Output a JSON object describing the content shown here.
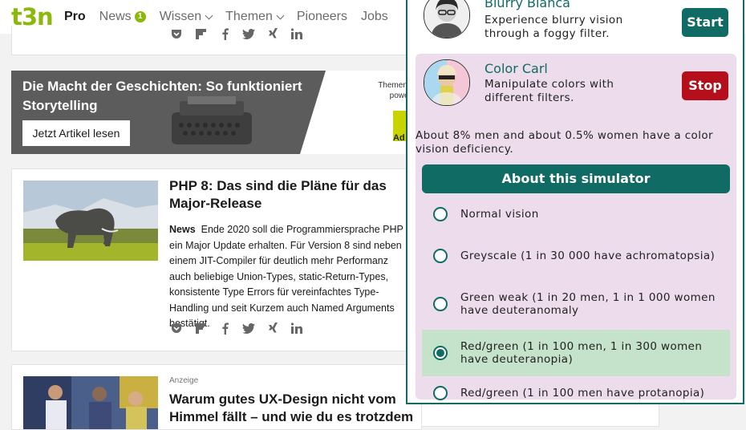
{
  "nav": {
    "logo": "t3n",
    "items": [
      {
        "label": "Pro"
      },
      {
        "label": "News",
        "badge": "1"
      },
      {
        "label": "Wissen"
      },
      {
        "label": "Themen"
      },
      {
        "label": "Pioneers"
      },
      {
        "label": "Jobs"
      }
    ]
  },
  "share_icons": [
    "pocket-icon",
    "flipboard-icon",
    "facebook-icon",
    "twitter-icon",
    "xing-icon",
    "linkedin-icon"
  ],
  "promo": {
    "title": "Die Macht der Geschichten: So funktioniert Storytelling",
    "button": "Jetzt Artikel lesen",
    "sponsor_line1": "Themenspe",
    "sponsor_line2": "powered",
    "sponsor_logo_text": "Ad"
  },
  "article": {
    "title": "PHP 8: Das sind die Pläne für das Major-Release",
    "tag": "News",
    "body": "Ende 2020 soll die Programmiersprache PHP ein Major Update erhalten. Für Version 8 sind neben einem JIT-Compiler für deutlich mehr Performanz auch beliebige Union-Types, static-Return-Types, konsistente Type Errors für vereinfachtes Type-Handling und seit Kurzem auch Named Arguments bestätigt."
  },
  "ad_article": {
    "label": "Anzeige",
    "title": "Warum gutes UX-Design nicht vom Himmel fällt – und wie du es trotzdem"
  },
  "simulator": {
    "blurry": {
      "name": "Blurry Bianca",
      "desc": "Experience blurry vision through a foggy filter.",
      "button": "Start"
    },
    "color": {
      "name": "Color Carl",
      "desc": "Manipulate colors with different filters.",
      "button": "Stop"
    },
    "stat": "About 8% men and about 0.5% women have a color vision deficiency.",
    "about_label": "About this simulator",
    "options": [
      {
        "label": "Normal vision",
        "selected": false
      },
      {
        "label": "Greyscale (1 in 30 000 have achromatopsia)",
        "selected": false
      },
      {
        "label": "Green weak (1 in 20 men, 1 in 1 000 women have deuteranomaly",
        "selected": false
      },
      {
        "label": "Red/green (1 in 100 men, 1 in 300 women have deuteranopia)",
        "selected": true
      },
      {
        "label": "Red/green (1 in 100 men have protanopia)",
        "selected": false
      }
    ]
  },
  "colors": {
    "brand_green": "#8ab80b",
    "sim_teal": "#0f6b63",
    "stop_red": "#b40f1a",
    "sim_bg": "#ecdcec",
    "selected_bg": "#c5e2cb"
  }
}
